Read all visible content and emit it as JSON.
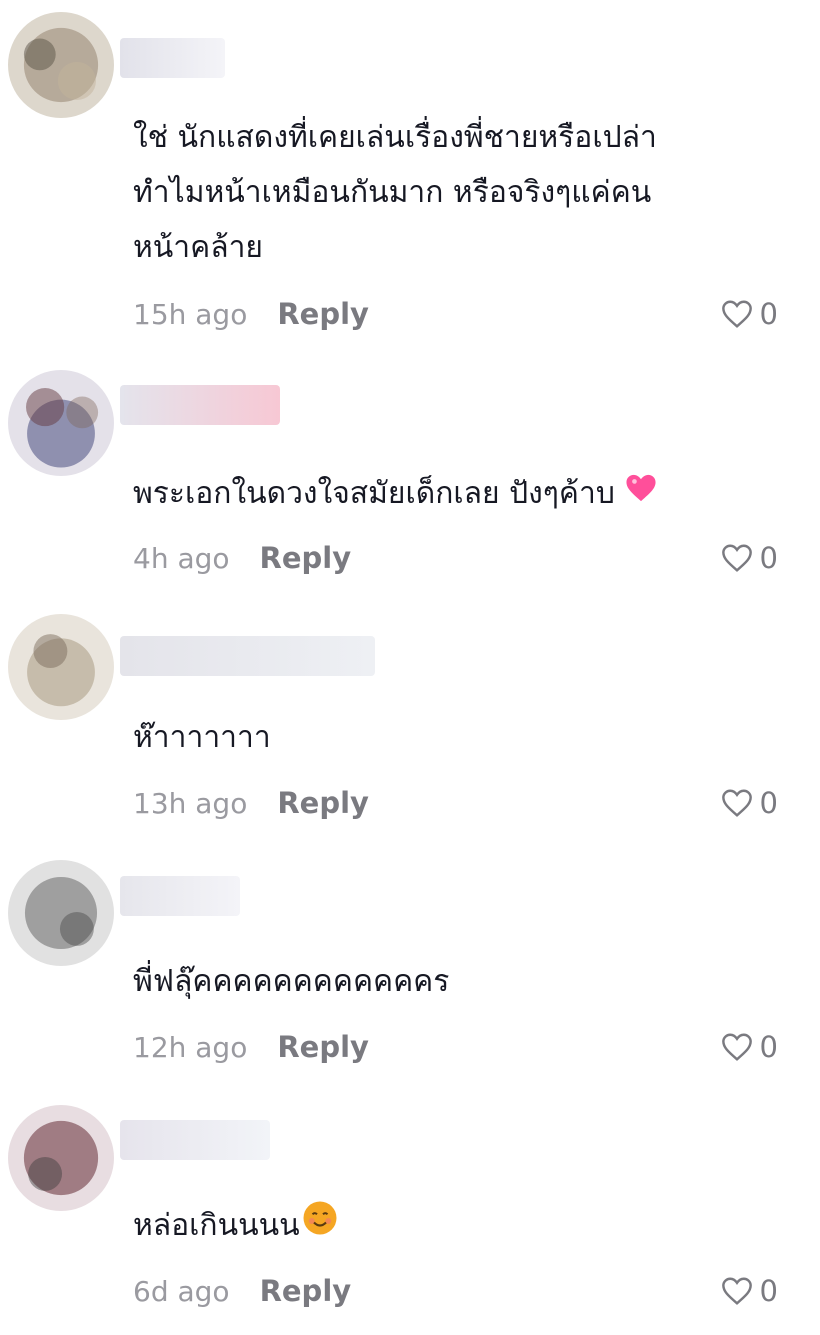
{
  "comments": [
    {
      "text": "ใช่ นักแสดงที่เคยเล่นเรื่องพี่ชายหรือเปล่า\nทำไมหน้าเหมือนกันมาก หรือจริงๆแค่คน\nหน้าคล้าย",
      "time": "15h ago",
      "reply_label": "Reply",
      "likes": "0",
      "emoji": ""
    },
    {
      "text": "พระเอกในดวงใจสมัยเด็กเลย ปังๆค้าบ",
      "time": "4h ago",
      "reply_label": "Reply",
      "likes": "0",
      "emoji": "pink-heart"
    },
    {
      "text": "ห๊าาาาาาา",
      "time": "13h ago",
      "reply_label": "Reply",
      "likes": "0",
      "emoji": ""
    },
    {
      "text": "พี่ฟลุ๊คคคคคคคคคคคคร",
      "time": "12h ago",
      "reply_label": "Reply",
      "likes": "0",
      "emoji": ""
    },
    {
      "text": "หล่อเกินนนน",
      "time": "6d ago",
      "reply_label": "Reply",
      "likes": "0",
      "emoji": "smiling-face"
    }
  ],
  "colors": {
    "text": "#161823",
    "meta": "#9a9aa0",
    "reply": "#7a7a80",
    "heart_emoji": "#ff4f9a",
    "smile_emoji": "#f5a623"
  }
}
